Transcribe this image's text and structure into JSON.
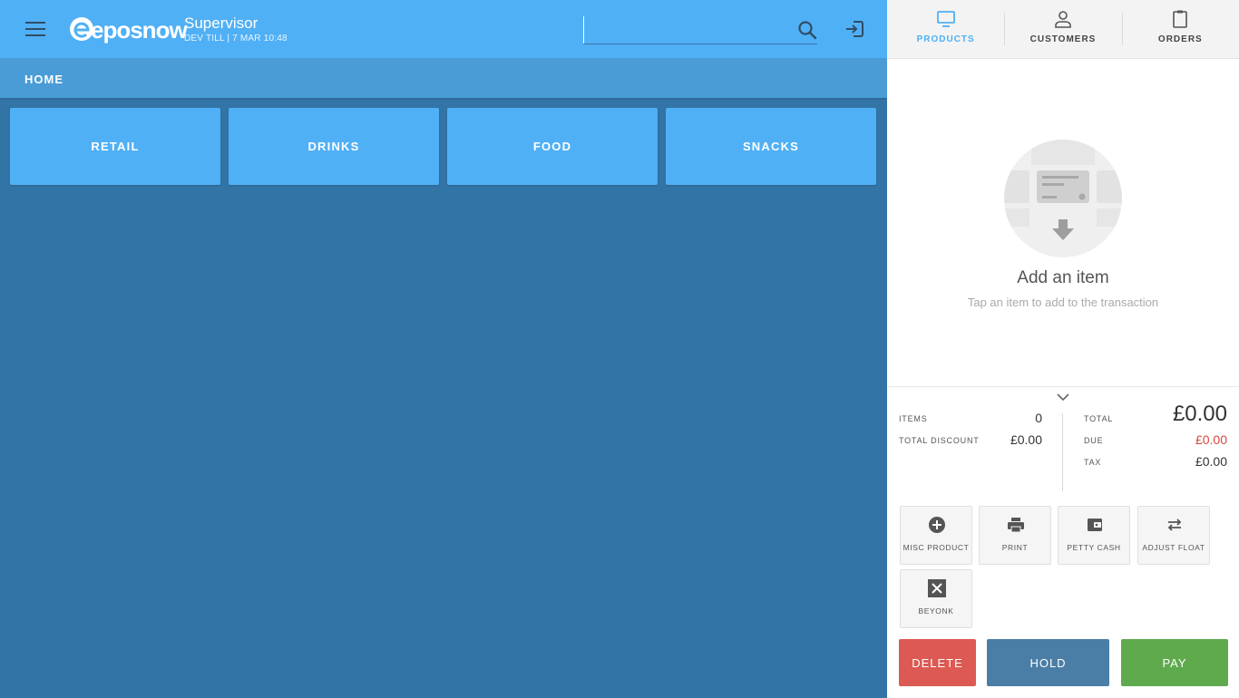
{
  "header": {
    "brand": "eposnow",
    "user_name": "Supervisor",
    "user_sub": "DEV TILL | 7 MAR 10:48",
    "search_placeholder": ""
  },
  "breadcrumb": "HOME",
  "categories": [
    "RETAIL",
    "DRINKS",
    "FOOD",
    "SNACKS"
  ],
  "tabs": [
    {
      "label": "PRODUCTS",
      "icon": "monitor-icon",
      "active": true
    },
    {
      "label": "CUSTOMERS",
      "icon": "user-icon",
      "active": false
    },
    {
      "label": "ORDERS",
      "icon": "clipboard-icon",
      "active": false
    }
  ],
  "empty_state": {
    "title": "Add an item",
    "subtitle": "Tap an item to add to the transaction"
  },
  "summary": {
    "items_label": "ITEMS",
    "items_value": "0",
    "discount_label": "TOTAL DISCOUNT",
    "discount_value": "£0.00",
    "total_label": "TOTAL",
    "total_value": "£0.00",
    "due_label": "DUE",
    "due_value": "£0.00",
    "tax_label": "TAX",
    "tax_value": "£0.00"
  },
  "actions": [
    {
      "label": "MISC PRODUCT",
      "icon": "plus-circle-icon"
    },
    {
      "label": "PRINT",
      "icon": "printer-icon"
    },
    {
      "label": "PETTY CASH",
      "icon": "wallet-icon"
    },
    {
      "label": "ADJUST FLOAT",
      "icon": "swap-icon"
    },
    {
      "label": "BEYONK",
      "icon": "beyonk-icon"
    }
  ],
  "buttons": {
    "delete": "DELETE",
    "hold": "HOLD",
    "pay": "PAY"
  },
  "colors": {
    "primary": "#50b0f5",
    "background": "#3374a6",
    "delete": "#dc5a53",
    "hold": "#4b7ea6",
    "pay": "#5eaa4d",
    "due": "#d9463e"
  }
}
